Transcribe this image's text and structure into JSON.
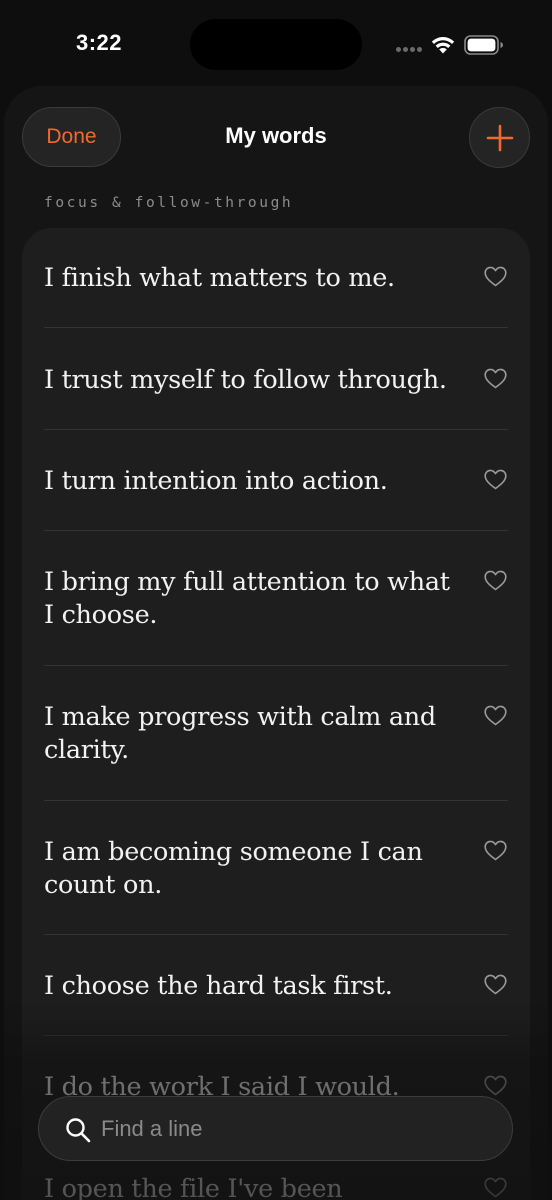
{
  "status_bar": {
    "time": "3:22"
  },
  "header": {
    "done_label": "Done",
    "title": "My words",
    "add_icon": "plus-icon"
  },
  "section": {
    "label": "focus & follow-through"
  },
  "affirmations": [
    {
      "text": "I finish what matters to me.",
      "favorited": false
    },
    {
      "text": "I trust myself to follow through.",
      "favorited": false
    },
    {
      "text": "I turn intention into action.",
      "favorited": false
    },
    {
      "text": "I bring my full attention to what I choose.",
      "favorited": false
    },
    {
      "text": "I make progress with calm and clarity.",
      "favorited": false
    },
    {
      "text": "I am becoming someone I can count on.",
      "favorited": false
    },
    {
      "text": "I choose the hard task first.",
      "favorited": false
    },
    {
      "text": "I do the work I said I would.",
      "favorited": false
    },
    {
      "text": "I open the file I've been avoiding.",
      "favorited": false
    }
  ],
  "search": {
    "placeholder": "Find a line",
    "value": ""
  },
  "colors": {
    "accent": "#f06a2f",
    "background": "#0e0e0e",
    "card": "#1e1e1e",
    "text": "#f2f2f2"
  }
}
